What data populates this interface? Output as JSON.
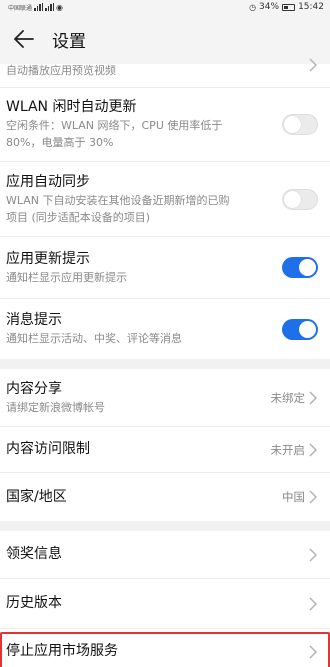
{
  "status_bar": {
    "carrier": "中国联通",
    "battery": "34%",
    "time": "15:42"
  },
  "header": {
    "title": "设置"
  },
  "settings": [
    {
      "subtitle": "自动播放应用预览视频"
    },
    {
      "title": "WLAN 闲时自动更新",
      "subtitle_line1": "空闲条件：WLAN 网络下，CPU 使用率低于",
      "subtitle_line2": "80%，电量高于 30%",
      "enabled": false
    },
    {
      "title": "应用自动同步",
      "subtitle_line1": "WLAN 下自动安装在其他设备近期新增的已购",
      "subtitle_line2": "项目 (同步适配本设备的项目)",
      "enabled": false
    },
    {
      "title": "应用更新提示",
      "subtitle": "通知栏显示应用更新提示",
      "enabled": true
    },
    {
      "title": "消息提示",
      "subtitle": "通知栏显示活动、中奖、评论等消息",
      "enabled": true
    }
  ],
  "account": [
    {
      "title": "内容分享",
      "subtitle": "请绑定新浪微博帐号",
      "value": "未绑定"
    },
    {
      "title": "内容访问限制",
      "value": "未开启"
    },
    {
      "title": "国家/地区",
      "value": "中国"
    }
  ],
  "misc": [
    {
      "title": "领奖信息"
    },
    {
      "title": "历史版本"
    },
    {
      "title": "停止应用市场服务"
    }
  ],
  "colors": {
    "toggle_on": "#1e70e8",
    "highlight_border": "#e33333"
  }
}
